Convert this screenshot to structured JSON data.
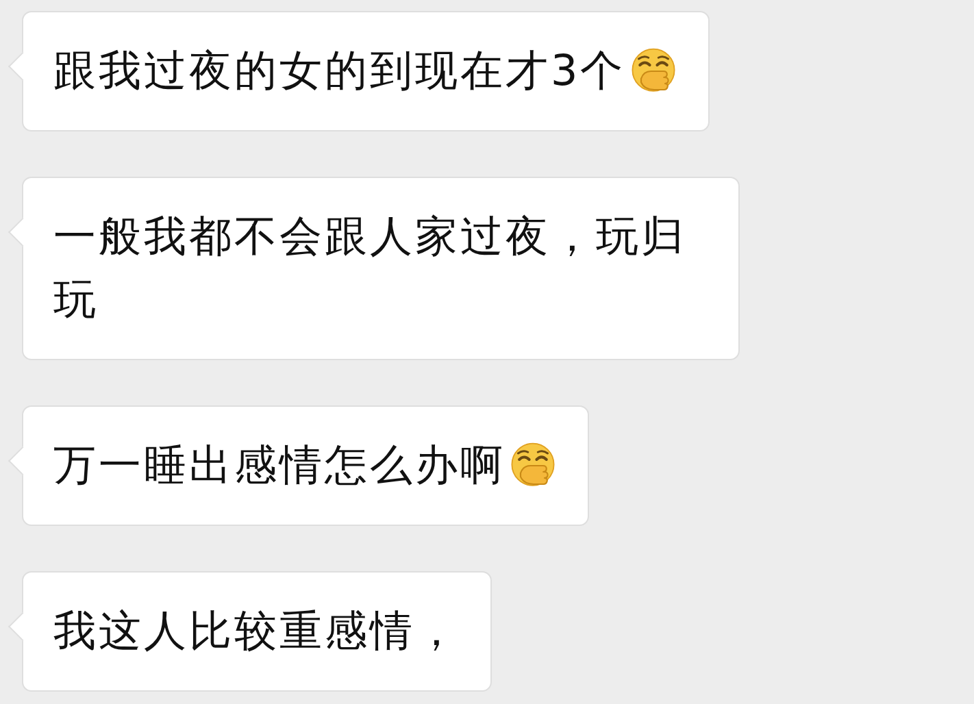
{
  "messages": [
    {
      "text": "跟我过夜的女的到现在才3个",
      "trailing_emoji": true
    },
    {
      "text": "一般我都不会跟人家过夜，玩归玩",
      "trailing_emoji": false
    },
    {
      "text": "万一睡出感情怎么办啊",
      "trailing_emoji": true
    },
    {
      "text": "我这人比较重感情，",
      "trailing_emoji": false
    }
  ]
}
